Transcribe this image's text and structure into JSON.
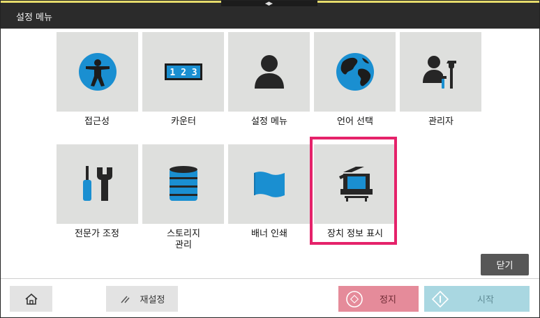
{
  "header": {
    "title": "설정 메뉴"
  },
  "tiles": [
    {
      "label": "접근성",
      "icon": "accessibility-icon"
    },
    {
      "label": "카운터",
      "icon": "counter-icon",
      "counter_digits": "1 2 3"
    },
    {
      "label": "설정 메뉴",
      "icon": "person-icon"
    },
    {
      "label": "언어 선택",
      "icon": "globe-icon"
    },
    {
      "label": "관리자",
      "icon": "admin-icon"
    },
    {
      "label": "전문가 조정",
      "icon": "tools-icon"
    },
    {
      "label_line1": "스토리지",
      "label_line2": "관리",
      "icon": "database-icon"
    },
    {
      "label": "배너 인쇄",
      "icon": "banner-icon"
    },
    {
      "label": "장치 정보 표시",
      "icon": "device-info-icon"
    }
  ],
  "footer": {
    "close_label": "닫기",
    "reset_label": "재설정",
    "stop_label": "정지",
    "start_label": "시작"
  },
  "colors": {
    "accent_blue": "#1a8fd1",
    "highlight": "#e5226a",
    "tile_bg": "#dedfdd"
  }
}
